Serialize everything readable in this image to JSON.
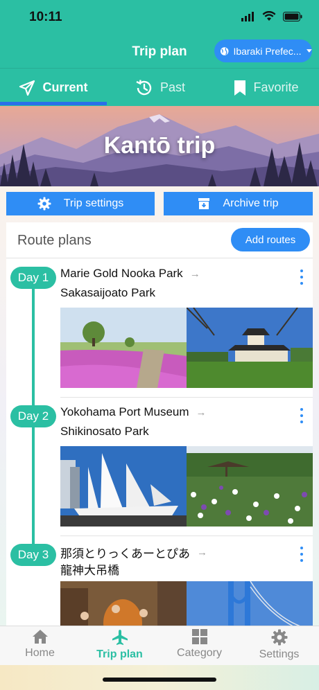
{
  "status": {
    "time": "10:11"
  },
  "nav": {
    "title": "Trip plan",
    "region": "Ibaraki Prefec..."
  },
  "tabs": [
    {
      "label": "Current",
      "icon": "paper-plane-icon",
      "active": true
    },
    {
      "label": "Past",
      "icon": "history-icon",
      "active": false
    },
    {
      "label": "Favorite",
      "icon": "bookmark-icon",
      "active": false
    }
  ],
  "hero": {
    "title": "Kantō trip"
  },
  "actions": {
    "trip_settings": "Trip settings",
    "archive_trip": "Archive trip"
  },
  "route_plans": {
    "title": "Route plans",
    "add_label": "Add routes",
    "days": [
      {
        "badge": "Day 1",
        "from": "Marie Gold Nooka Park",
        "to": "Sakasaijoato Park"
      },
      {
        "badge": "Day 2",
        "from": "Yokohama Port Museum",
        "to": "Shikinosato Park"
      },
      {
        "badge": "Day 3",
        "from": "那須とりっくあーとぴあ",
        "to": "龍神大吊橋"
      }
    ]
  },
  "tabbar": [
    {
      "label": "Home",
      "icon": "home-icon"
    },
    {
      "label": "Trip plan",
      "icon": "airplane-icon",
      "active": true
    },
    {
      "label": "Category",
      "icon": "grid-icon"
    },
    {
      "label": "Settings",
      "icon": "gear-icon"
    }
  ],
  "colors": {
    "teal": "#2bbfa3",
    "blue": "#2f8df5",
    "indicator": "#2a6fe8"
  }
}
